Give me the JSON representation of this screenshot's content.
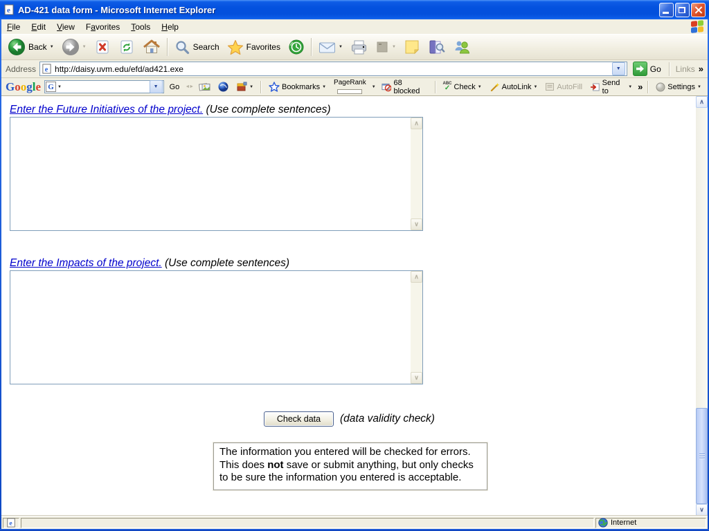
{
  "window": {
    "title": "AD-421 data form - Microsoft Internet Explorer"
  },
  "menu_bar": {
    "items": [
      {
        "pre": "",
        "key": "F",
        "post": "ile"
      },
      {
        "pre": "",
        "key": "E",
        "post": "dit"
      },
      {
        "pre": "",
        "key": "V",
        "post": "iew"
      },
      {
        "pre": "F",
        "key": "a",
        "post": "vorites"
      },
      {
        "pre": "",
        "key": "T",
        "post": "ools"
      },
      {
        "pre": "",
        "key": "H",
        "post": "elp"
      }
    ]
  },
  "toolbar": {
    "back_label": "Back",
    "search_label": "Search",
    "favorites_label": "Favorites"
  },
  "address_bar": {
    "label": "Address",
    "url": "http://daisy.uvm.edu/efd/ad421.exe",
    "go_label": "Go",
    "links_label": "Links"
  },
  "google_toolbar": {
    "logo_letters": [
      "G",
      "o",
      "o",
      "g",
      "l",
      "e"
    ],
    "search_value": "",
    "go_label": "Go",
    "bookmarks_label": "Bookmarks",
    "pagerank_label": "PageRank",
    "blocked_label": "68 blocked",
    "check_abc": "ABC",
    "check_label": "Check",
    "autolink_label": "AutoLink",
    "autofill_label": "AutoFill",
    "sendto_label": "Send to",
    "settings_label": "Settings"
  },
  "page": {
    "future_initiatives": {
      "link_text": "Enter the Future Initiatives of the project.",
      "hint_text": "(Use complete sentences)",
      "value": ""
    },
    "impacts": {
      "link_text": "Enter the Impacts of the project.",
      "hint_text": "(Use complete sentences)",
      "value": ""
    },
    "check_button_label": "Check data",
    "check_hint": "(data validity check)",
    "info_box": {
      "text_before_bold": "The information you entered will be checked for errors. This does ",
      "bold_text": "not",
      "text_after_bold": " save or submit anything, but only checks to be sure the information you entered is acceptable."
    }
  },
  "status_bar": {
    "zone_label": "Internet"
  },
  "glyphs": {
    "caret_down": "▼",
    "chevron_more": "»",
    "scroll_up": "∧",
    "scroll_down": "∨",
    "check_mark": "✓",
    "grip": "◄►",
    "ie_e": "e"
  },
  "colors": {
    "titlebar_blue": "#0350dc",
    "luna_beige": "#f1efe2",
    "link_blue": "#0000cc",
    "go_green": "#2f9b38",
    "input_border": "#7f9db9"
  }
}
